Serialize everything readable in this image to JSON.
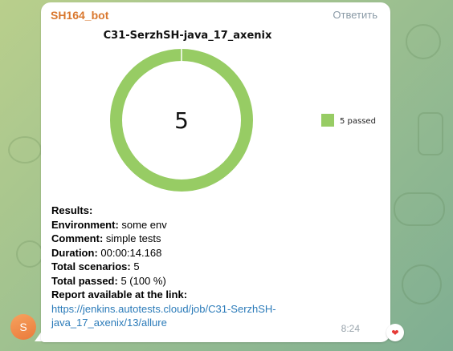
{
  "message": {
    "sender": "SH164_bot",
    "reply_label": "Ответить",
    "time": "8:24",
    "avatar_letter": "S",
    "reaction": "❤"
  },
  "chart_data": {
    "type": "pie",
    "title": "C31-SerzhSH-java_17_axenix",
    "center_label": "5",
    "series": [
      {
        "name": "5 passed",
        "value": 5,
        "color": "#97cc64"
      }
    ],
    "legend_position": "right"
  },
  "results": {
    "heading": "Results:",
    "environment_label": "Environment:",
    "environment_value": " some env",
    "comment_label": "Comment:",
    "comment_value": " simple tests",
    "duration_label": "Duration:",
    "duration_value": " 00:00:14.168",
    "total_scenarios_label": "Total scenarios:",
    "total_scenarios_value": " 5",
    "total_passed_label": "Total passed:",
    "total_passed_value": " 5 (100 %)",
    "report_label": "Report available at the link:",
    "report_link_line1": "https://jenkins.autotests.cloud/job/C31-SerzhSH-",
    "report_link_line2": "java_17_axenix/13/allure"
  },
  "colors": {
    "accent_sender": "#d9772e",
    "link": "#2b7bb9",
    "passed": "#97cc64"
  }
}
